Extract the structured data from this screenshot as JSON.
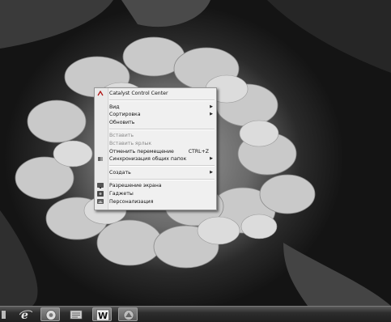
{
  "context_menu": {
    "items": [
      {
        "label": "Catalyst Control Center",
        "icon": "catalyst-icon",
        "disabled": false
      },
      {
        "separator": true
      },
      {
        "label": "Вид",
        "submenu": true
      },
      {
        "label": "Сортировка",
        "submenu": true
      },
      {
        "label": "Обновить"
      },
      {
        "separator": true
      },
      {
        "label": "Вставить",
        "disabled": true
      },
      {
        "label": "Вставить ярлык",
        "disabled": true
      },
      {
        "label": "Отменить перемещение",
        "shortcut": "CTRL+Z"
      },
      {
        "label": "Синхронизация общих папок",
        "icon": "sync-icon",
        "submenu": true
      },
      {
        "separator": true
      },
      {
        "label": "Создать",
        "submenu": true
      },
      {
        "separator": true
      },
      {
        "label": "Разрешение экрана",
        "icon": "screen-resolution-icon"
      },
      {
        "label": "Гаджеты",
        "icon": "gadgets-icon"
      },
      {
        "label": "Персонализация",
        "icon": "personalization-icon"
      }
    ]
  },
  "taskbar": {
    "buttons": [
      {
        "name": "start-button",
        "icon": "start-orb-icon"
      },
      {
        "name": "internet-explorer",
        "icon": "ie-icon"
      },
      {
        "name": "media-player",
        "icon": "media-player-icon"
      },
      {
        "name": "explorer",
        "icon": "file-explorer-icon"
      },
      {
        "name": "word",
        "icon": "word-icon",
        "letter": "W"
      },
      {
        "name": "unknown-app",
        "icon": "app-icon"
      }
    ]
  }
}
